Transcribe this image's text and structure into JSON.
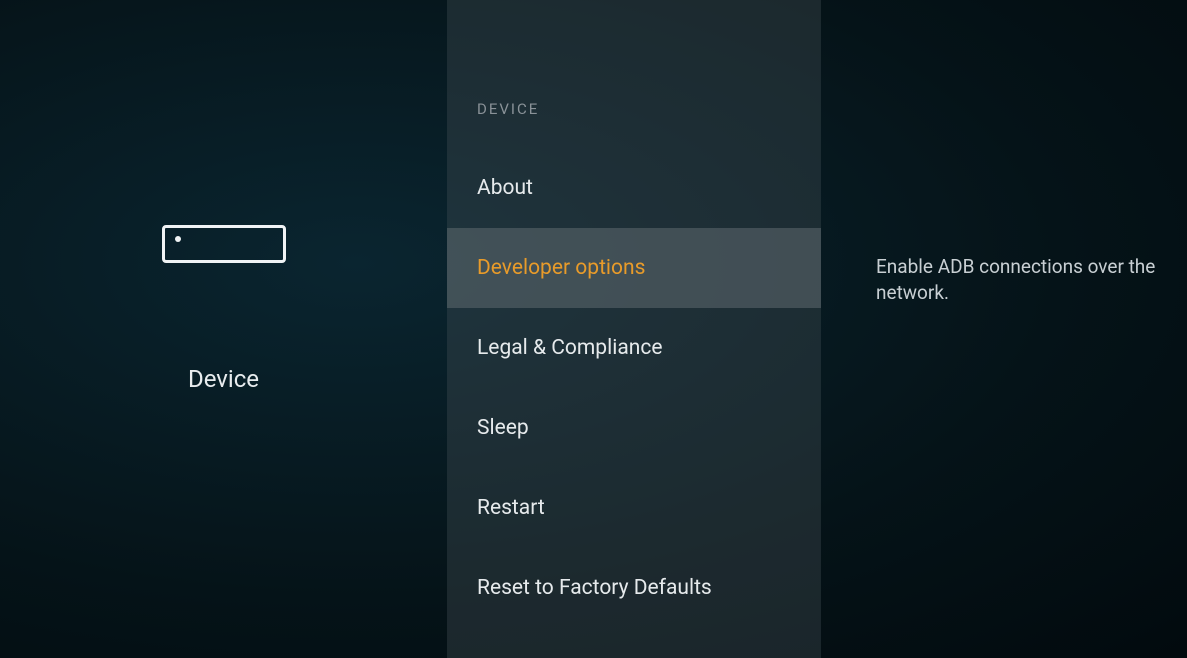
{
  "category": {
    "title": "Device"
  },
  "menu": {
    "header": "DEVICE",
    "items": [
      {
        "label": "About",
        "selected": false
      },
      {
        "label": "Developer options",
        "selected": true
      },
      {
        "label": "Legal & Compliance",
        "selected": false
      },
      {
        "label": "Sleep",
        "selected": false
      },
      {
        "label": "Restart",
        "selected": false
      },
      {
        "label": "Reset to Factory Defaults",
        "selected": false
      }
    ]
  },
  "description": {
    "text": "Enable ADB connections over the network."
  }
}
